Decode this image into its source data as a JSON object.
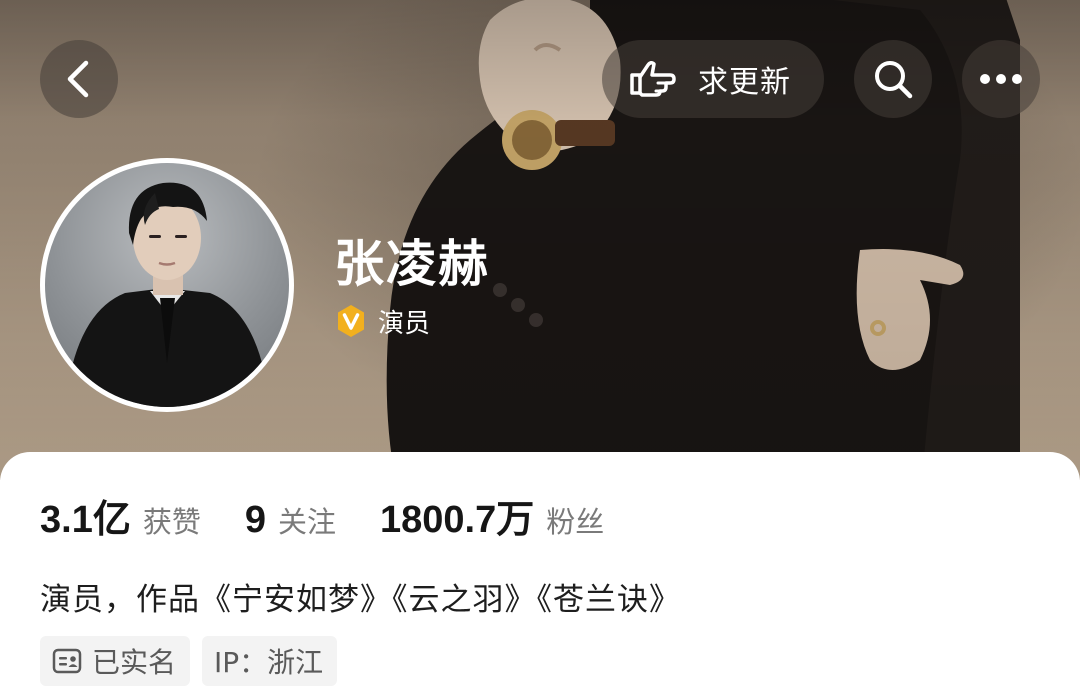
{
  "header": {
    "urge_update_label": "求更新",
    "icons": [
      "back-arrow-icon",
      "hand-point-icon",
      "search-icon",
      "more-icon"
    ]
  },
  "profile": {
    "name": "张凌赫",
    "verified_role": "演员",
    "verified_badge_color": "#f2b01e"
  },
  "stats": {
    "likes": {
      "value": "3.1亿",
      "label": "获赞"
    },
    "following": {
      "value": "9",
      "label": "关注"
    },
    "followers": {
      "value": "1800.7万",
      "label": "粉丝"
    }
  },
  "bio": "演员，作品《宁安如梦》《云之羽》《苍兰诀》",
  "tags": {
    "real_name": "已实名",
    "ip_location": "IP：浙江"
  }
}
